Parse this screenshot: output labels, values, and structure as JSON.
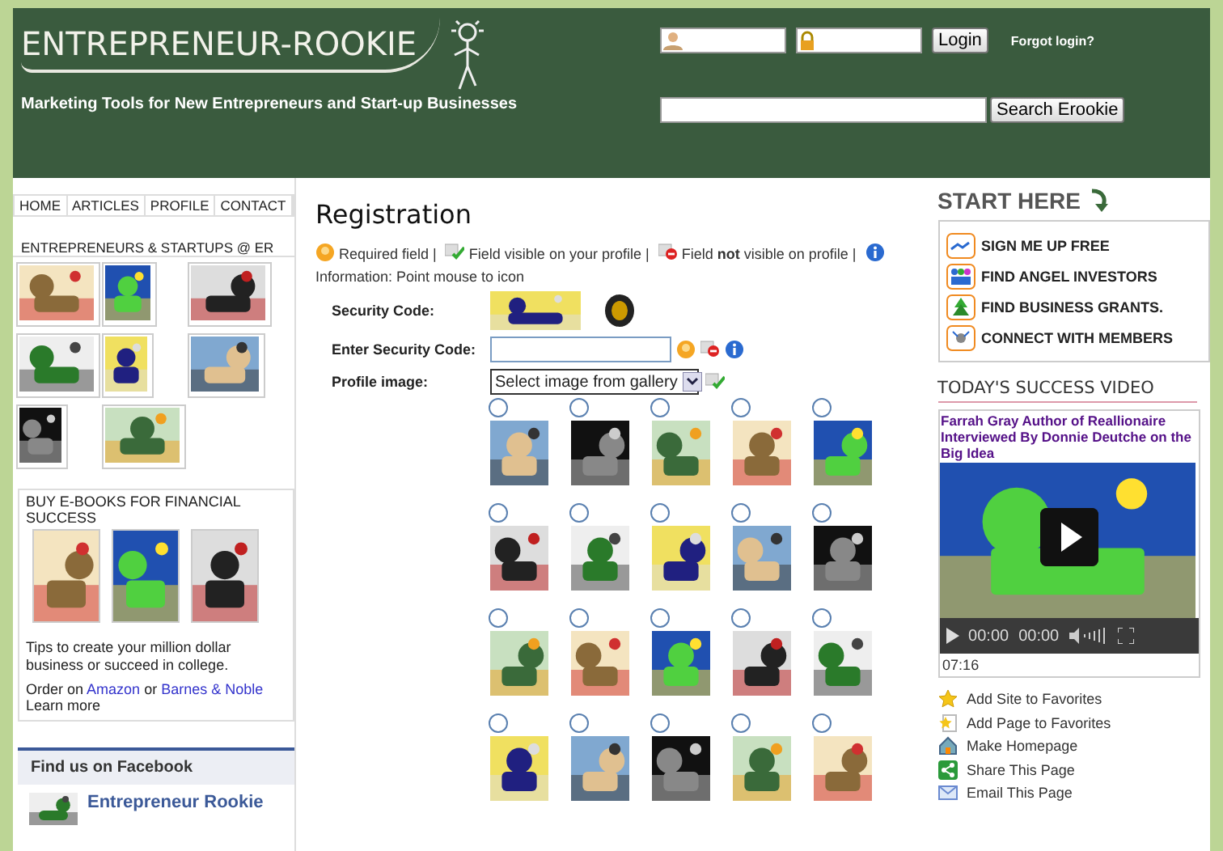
{
  "header": {
    "logo": "ENTREPRENEUR-ROOKIE",
    "tagline": "Marketing Tools for New Entrepreneurs and Start-up Businesses",
    "login_button": "Login",
    "forgot_link": "Forgot login?",
    "search_button": "Search Erookie"
  },
  "nav": [
    "HOME",
    "ARTICLES",
    "PROFILE",
    "CONTACT"
  ],
  "members": {
    "title": "ENTREPRENEURS & STARTUPS @ ER"
  },
  "ebooks": {
    "title": "BUY E-BOOKS FOR FINANCIAL SUCCESS",
    "tips": "Tips to create your million dollar business or succeed in college.",
    "order_before": "Order on",
    "link_1": "Amazon",
    "order_middle": "or",
    "link_2": "Barnes & Noble",
    "learn_more": "Learn more"
  },
  "facebook": {
    "title": "Find us on Facebook",
    "page": "Entrepreneur Rookie"
  },
  "registration": {
    "title": "Registration",
    "legend": [
      {
        "kind": "required",
        "text": "Required field |"
      },
      {
        "kind": "visible",
        "text": "Field visible on your profile |"
      },
      {
        "kind": "hidden",
        "text": "Field **not** visible on profile |"
      },
      {
        "kind": "info",
        "text": "Information: Point mouse to icon"
      }
    ],
    "security_label": "Security Code:",
    "enter_label": "Enter Security Code:",
    "profile_label": "Profile image:",
    "select": "Select image from gallery",
    "gallery": [
      {
        "selected": false
      },
      {
        "selected": false
      },
      {
        "selected": false
      },
      {
        "selected": false
      },
      {
        "selected": false
      },
      {
        "selected": false
      },
      {
        "selected": false
      },
      {
        "selected": false
      },
      {
        "selected": false
      },
      {
        "selected": false
      },
      {
        "selected": false
      },
      {
        "selected": false
      },
      {
        "selected": false
      },
      {
        "selected": false
      },
      {
        "selected": false
      },
      {
        "selected": false
      },
      {
        "selected": false
      },
      {
        "selected": false
      },
      {
        "selected": false
      },
      {
        "selected": false
      }
    ]
  },
  "start_here": {
    "title": "START HERE",
    "links": [
      {
        "kind": "signup",
        "label": "SIGN ME UP FREE"
      },
      {
        "kind": "investors",
        "label": "FIND ANGEL INVESTORS"
      },
      {
        "kind": "grants",
        "label": "FIND BUSINESS GRANTS."
      },
      {
        "kind": "connect",
        "label": "CONNECT WITH MEMBERS"
      }
    ]
  },
  "video": {
    "title": "TODAY'S SUCCESS VIDEO",
    "caption": "Farrah Gray Author of Reallionaire Interviewed By Donnie Deutche on the Big Idea",
    "time_current": "00:00",
    "time_total": "00:00",
    "duration": "07:16"
  },
  "actions": [
    {
      "kind": "star",
      "label": "Add Site to Favorites"
    },
    {
      "kind": "page-star",
      "label": "Add Page to Favorites"
    },
    {
      "kind": "home",
      "label": "Make Homepage"
    },
    {
      "kind": "share",
      "label": "Share This Page"
    },
    {
      "kind": "email",
      "label": "Email This Page"
    }
  ]
}
